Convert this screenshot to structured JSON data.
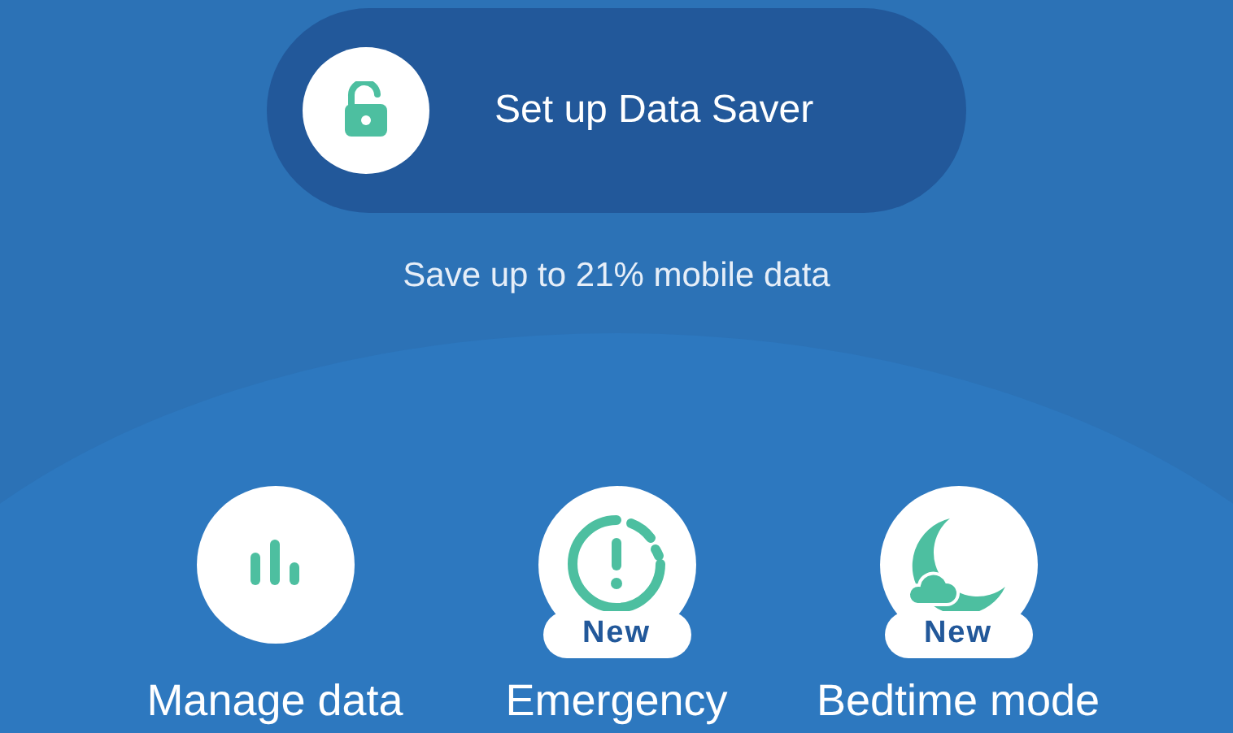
{
  "data_saver": {
    "button": "Set up Data Saver",
    "subtitle": "Save up to 21% mobile data"
  },
  "features": [
    {
      "kind": "chart",
      "label": "Manage data"
    },
    {
      "kind": "alert",
      "label": "Emergency",
      "badge": "New"
    },
    {
      "kind": "moon",
      "label": "Bedtime mode",
      "badge": "New"
    }
  ]
}
